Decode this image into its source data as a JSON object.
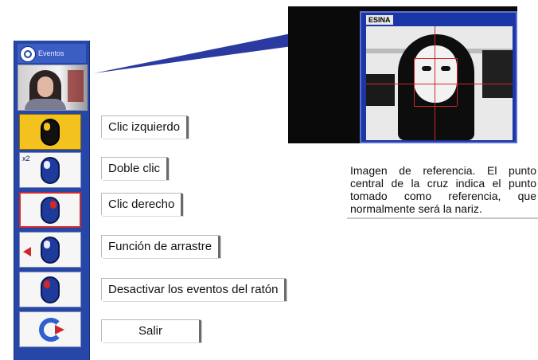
{
  "toolbar": {
    "title": "Eventos",
    "tools": [
      {
        "name": "left-click",
        "state": "active"
      },
      {
        "name": "double-click",
        "badge": "x2"
      },
      {
        "name": "right-click",
        "state": "selected"
      },
      {
        "name": "drag"
      },
      {
        "name": "disable-events"
      },
      {
        "name": "exit"
      }
    ]
  },
  "menu": {
    "left_click": "Clic izquierdo",
    "double_click": "Doble clic",
    "right_click": "Clic derecho",
    "drag": "Función de arrastre",
    "disable": "Desactivar los eventos del ratón",
    "exit": "Salir"
  },
  "reference": {
    "tag": "ESINA",
    "caption": "Imagen de referencia. El punto central de la cruz indica el punto tomado como referencia, que normalmente será la nariz."
  },
  "colors": {
    "toolbar_blue": "#2747a8",
    "active_yellow": "#f4c21e",
    "cross_red": "#d0282a"
  }
}
